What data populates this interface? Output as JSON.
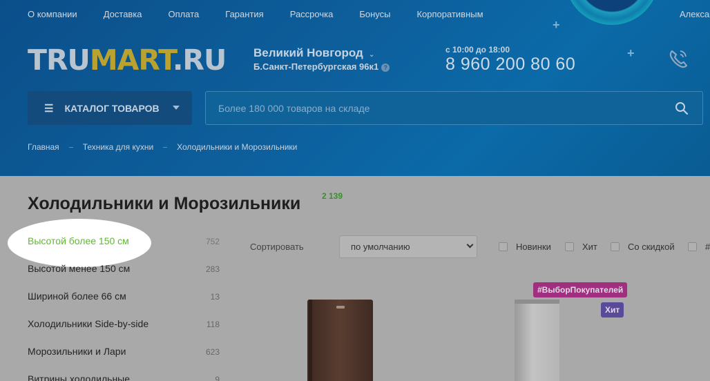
{
  "topnav": {
    "items": [
      "О компании",
      "Доставка",
      "Оплата",
      "Гарантия",
      "Рассрочка",
      "Бонусы",
      "Корпоративным"
    ],
    "user": "Алексан"
  },
  "logo": {
    "part1": "TRU",
    "part2": "MART",
    "part3": ".RU"
  },
  "location": {
    "city": "Великий Новгород",
    "address": "Б.Санкт-Петербургская 96к1"
  },
  "contact": {
    "hours": "с 10:00 до 18:00",
    "phone": "8 960 200 80 60"
  },
  "catalog": {
    "label": "КАТАЛОГ ТОВАРОВ"
  },
  "search": {
    "placeholder": "Более 180 000 товаров на складе"
  },
  "breadcrumb": [
    "Главная",
    "Техника для кухни",
    "Холодильники и Морозильники"
  ],
  "page": {
    "title": "Холодильники и Морозильники",
    "count": "2 139"
  },
  "categories": [
    {
      "label": "Высотой более 150 см",
      "count": "752",
      "active": true
    },
    {
      "label": "Высотой менее 150 см",
      "count": "283"
    },
    {
      "label": "Шириной более 66 см",
      "count": "13"
    },
    {
      "label": "Холодильники Side-by-side",
      "count": "118"
    },
    {
      "label": "Морозильники и Лари",
      "count": "623"
    },
    {
      "label": "Витрины холодильные",
      "count": "9"
    }
  ],
  "sort": {
    "label": "Сортировать",
    "value": "по умолчанию"
  },
  "filters": [
    "Новинки",
    "Хит",
    "Со скидкой",
    "#"
  ],
  "badges": {
    "choice": "#ВыборПокупателей",
    "hit": "Хит"
  },
  "colors": {
    "accent_green": "#5cbc29",
    "header_blue": "#0d5f9c",
    "logo_gold": "#b9a230"
  }
}
